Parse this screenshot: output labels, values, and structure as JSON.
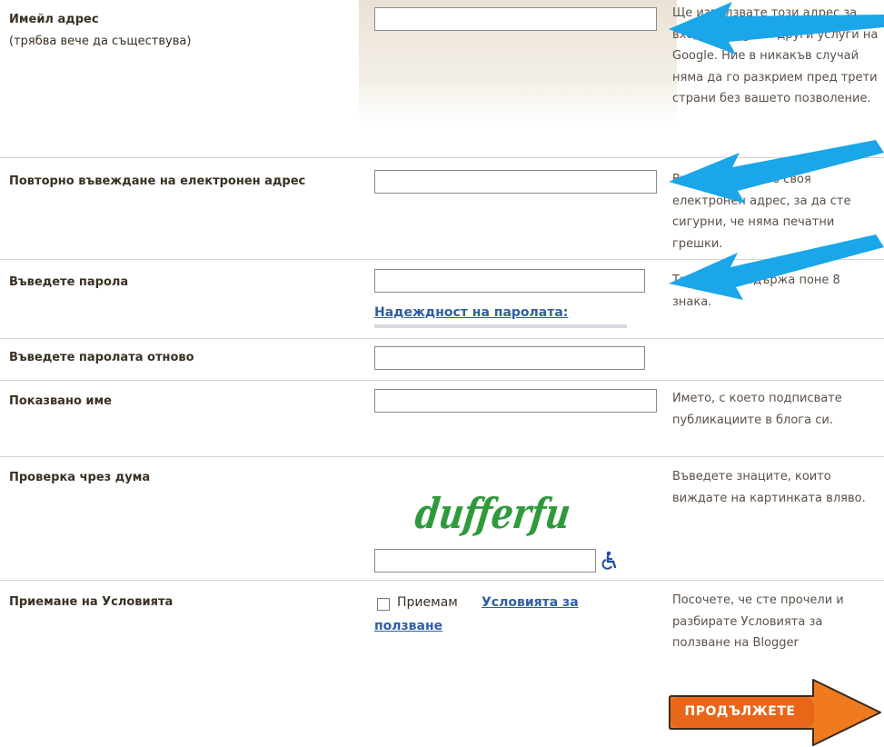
{
  "form": {
    "email": {
      "label": "Имейл адрес",
      "sublabel": "(трябва вече да съществува)",
      "value": "",
      "help": "Ще използвате този адрес за вход в Blogger и други услуги на Google. Ние в никакъв случай няма да го разкрием пред трети страни без вашето позволение."
    },
    "email_confirm": {
      "label": "Повторно въвеждане на електронен адрес",
      "value": "",
      "help": "Въведете отново своя електронен адрес, за да сте сигурни, че няма печатни грешки."
    },
    "password": {
      "label": "Въведете парола",
      "value": "",
      "strength_link": "Надеждност на паролата:",
      "help": "Трябва да съдържа поне 8 знака."
    },
    "password_confirm": {
      "label": "Въведете паролата отново",
      "value": ""
    },
    "display_name": {
      "label": "Показвано име",
      "value": "",
      "help": "Името, с което подписвате публикациите в блога си."
    },
    "word_verification": {
      "label": "Проверка чрез дума",
      "captcha_text": "dufferfu",
      "value": "",
      "accessibility_icon": "wheelchair-icon",
      "help": "Въведете знаците, които виждате на картинката вляво."
    },
    "terms": {
      "label": "Приемане на Условията",
      "checkbox_text": "Приемам",
      "checked": false,
      "link_text_line1": "Условията за",
      "link_text_line2": "ползване",
      "help": "Посочете, че сте прочели и разбирате Условията за ползване на Blogger"
    }
  },
  "continue_button": {
    "label": "ПРОДЪЛЖЕТЕ",
    "color": "#ef6c1a",
    "arrow_color": "#f07a1e"
  },
  "annotation_arrows": {
    "color": "#1aa6e8",
    "count": 4
  }
}
